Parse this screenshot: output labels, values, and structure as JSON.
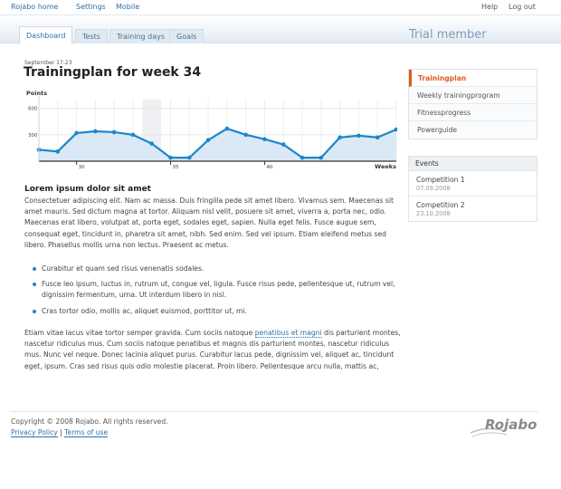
{
  "topnav": {
    "left": [
      "Rojabo home",
      "Settings",
      "Mobile"
    ],
    "right": [
      "Help",
      "Log out"
    ]
  },
  "tabs": [
    "Dashboard",
    "Tests",
    "Training days",
    "Goals"
  ],
  "active_tab": "Dashboard",
  "membership": "Trial member",
  "main": {
    "date_range": "September 17-23",
    "title": "Trainingplan for week 34",
    "section_heading": "Lorem ipsum dolor sit amet",
    "paragraph1": "Consectetuer adipiscing elit. Nam ac massa. Duis fringilla pede sit amet libero. Vivamus sem. Maecenas sit amet mauris. Sed dictum magna at tortor. Aliquam nisl velit, posuere sit amet, viverra a, porta nec, odio. Maecenas erat libero, volutpat at, porta eget, sodales eget, sapien. Nulla eget felis. Fusce augue sem, consequat eget, tincidunt in, pharetra sit amet, nibh. Sed enim. Sed vel ipsum. Etiam eleifend metus sed libero. Phasellus mollis urna non lectus. Praesent ac metus.",
    "bullets": [
      "Curabitur et quam sed risus venenatis sodales.",
      "Fusce leo ipsum, luctus in, rutrum ut, congue vel, ligula. Fusce risus pede, pellentesque ut, rutrum vel, dignissim fermentum, urna. Ut interdum libero in nisl.",
      "Cras tortor odio, mollis ac, aliquet euismod, porttitor ut, mi."
    ],
    "paragraph2_before_link": "Etiam vitae lacus vitae tortor semper gravida. Cum sociis natoque ",
    "paragraph2_link": "penatibus et magni",
    "paragraph2_after_link": " dis parturient montes, nascetur ridiculus mus. Cum sociis natoque penatibus et magnis dis parturient montes, nascetur ridiculus mus. Nunc vel neque. Donec lacinia aliquet purus. Curabitur lacus pede, dignissim vel, aliquet ac, tincidunt eget, ipsum. Cras sed risus quis odio molestie placerat. Proin libero. Pellentesque arcu nulla, mattis ac,"
  },
  "sidebar": {
    "nav": [
      "Trainingplan",
      "Weekly trainingprogram",
      "Fitnessprogress",
      "Powerguide"
    ],
    "active": "Trainingplan",
    "events_heading": "Events",
    "events": [
      {
        "name": "Competition 1",
        "date": "07.09.2008"
      },
      {
        "name": "Competition 2",
        "date": "23.10.2008"
      }
    ]
  },
  "footer": {
    "copyright": "Copyright © 2008 Rojabo. All rights reserved.",
    "privacy": "Privacy Policy",
    "separator": "|",
    "terms": "Terms of use",
    "logo_text": "Rojabo"
  },
  "chart_data": {
    "type": "area",
    "ylabel": "Points",
    "xlabel": "Weeks",
    "yticks": [
      300,
      600
    ],
    "ylim": [
      0,
      700
    ],
    "xticks": [
      30,
      35,
      40
    ],
    "x": [
      28,
      29,
      30,
      31,
      32,
      33,
      34,
      35,
      36,
      37,
      38,
      39,
      40,
      41,
      42,
      43,
      44,
      45,
      46,
      47
    ],
    "values": [
      130,
      110,
      320,
      340,
      330,
      300,
      200,
      40,
      40,
      240,
      370,
      300,
      250,
      190,
      40,
      40,
      270,
      290,
      270,
      360
    ],
    "highlight_x": 34,
    "grid": true,
    "colors": {
      "line": "#1b87c9",
      "fill": "#dbe9f6",
      "highlight": "#eef0f2"
    }
  },
  "colors": {
    "accent": "#e05a20",
    "link": "#2e6fa8",
    "brand_blue": "#7e9cb6"
  }
}
